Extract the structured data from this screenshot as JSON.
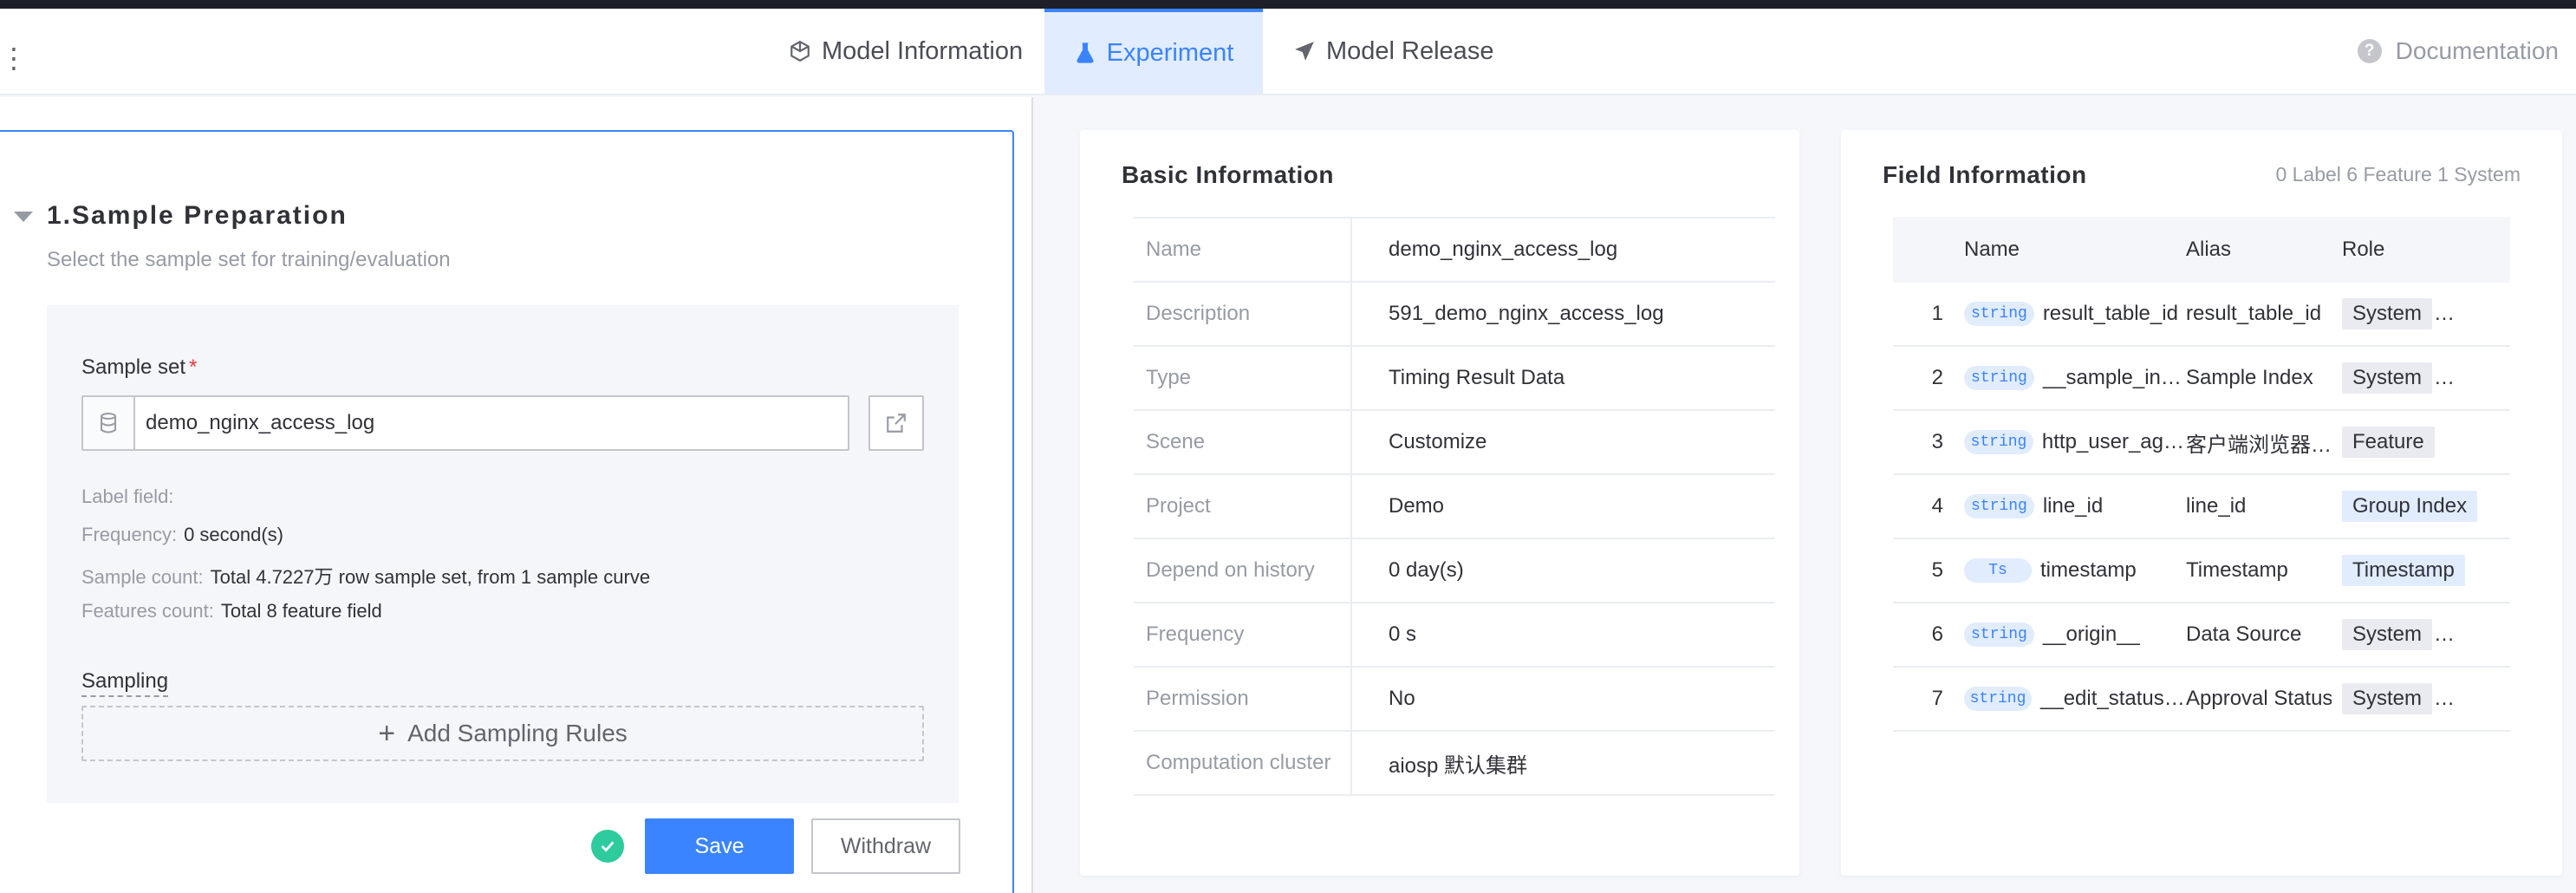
{
  "header": {
    "tabs": [
      {
        "label": "Model Information",
        "icon": "cube-icon"
      },
      {
        "label": "Experiment",
        "icon": "flask-icon",
        "active": true
      },
      {
        "label": "Model Release",
        "icon": "paper-plane-icon"
      }
    ],
    "doc_label": "Documentation",
    "doc_icon": "?"
  },
  "step": {
    "title": "1.Sample Preparation",
    "subtitle": "Select the sample set for training/evaluation",
    "sample_set_label": "Sample set",
    "required_mark": "*",
    "sample_set_value": "demo_nginx_access_log",
    "meta": {
      "label_field_key": "Label field:",
      "label_field_value": "",
      "frequency_key": "Frequency:",
      "frequency_value": "0 second(s)",
      "sample_count_key": "Sample count:",
      "sample_count_value": "Total 4.7227万 row sample set, from 1 sample curve",
      "features_count_key": "Features count:",
      "features_count_value": "Total 8 feature field"
    },
    "sampling_label": "Sampling",
    "add_rules_label": "Add Sampling Rules",
    "save_label": "Save",
    "withdraw_label": "Withdraw"
  },
  "basic": {
    "title": "Basic Information",
    "rows": [
      {
        "k": "Name",
        "v": "demo_nginx_access_log"
      },
      {
        "k": "Description",
        "v": "591_demo_nginx_access_log"
      },
      {
        "k": "Type",
        "v": "Timing Result Data"
      },
      {
        "k": "Scene",
        "v": "Customize"
      },
      {
        "k": "Project",
        "v": "Demo"
      },
      {
        "k": "Depend on history",
        "v": "0 day(s)"
      },
      {
        "k": "Frequency",
        "v": "0 s"
      },
      {
        "k": "Permission",
        "v": "No"
      },
      {
        "k": "Computation cluster",
        "v": "aiosp 默认集群"
      }
    ]
  },
  "fields": {
    "title": "Field Information",
    "summary": "0 Label 6 Feature 1 System",
    "columns": {
      "name": "Name",
      "alias": "Alias",
      "role": "Role"
    },
    "rows": [
      {
        "idx": "1",
        "type": "string",
        "name": "result_table_id",
        "alias": "result_table_id",
        "role": "System",
        "ellipsis": "…",
        "hl": false
      },
      {
        "idx": "2",
        "type": "string",
        "name": "__sample_in…",
        "alias": "Sample Index",
        "role": "System",
        "ellipsis": "…",
        "hl": false
      },
      {
        "idx": "3",
        "type": "string",
        "name": "http_user_ag…",
        "alias": "客户端浏览器…",
        "role": "Feature",
        "ellipsis": "",
        "hl": false
      },
      {
        "idx": "4",
        "type": "string",
        "name": "line_id",
        "alias": "line_id",
        "role": "Group Index",
        "ellipsis": "",
        "hl": true
      },
      {
        "idx": "5",
        "type": "Ts",
        "name": "timestamp",
        "alias": "Timestamp",
        "role": "Timestamp",
        "ellipsis": "",
        "hl": true
      },
      {
        "idx": "6",
        "type": "string",
        "name": "__origin__",
        "alias": "Data Source",
        "role": "System",
        "ellipsis": "…",
        "hl": false
      },
      {
        "idx": "7",
        "type": "string",
        "name": "__edit_status…",
        "alias": "Approval Status",
        "role": "System",
        "ellipsis": "…",
        "hl": false
      }
    ]
  },
  "colors": {
    "primary": "#3a84ff",
    "success": "#2dcb9d",
    "topbar": "#1e2029"
  }
}
